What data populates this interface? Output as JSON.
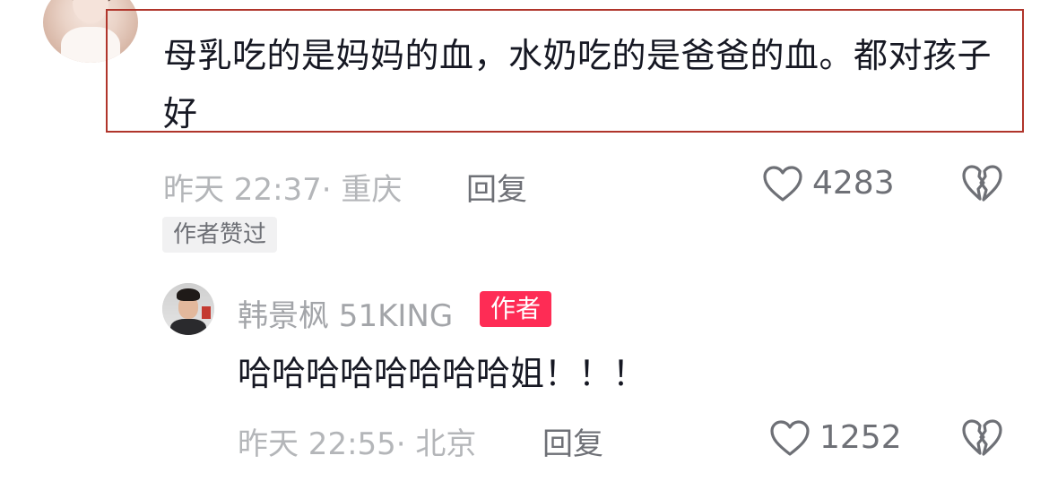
{
  "comment": {
    "text": "母乳吃的是妈妈的血，水奶吃的是爸爸的血。都对孩子好",
    "meta": "昨天 22:37· 重庆",
    "reply_label": "回复",
    "like_count": "4283",
    "badge": "作者赞过"
  },
  "reply": {
    "username": "韩景枫 51KING",
    "author_badge": "作者",
    "text": "哈哈哈哈哈哈哈哈姐！！！",
    "meta": "昨天 22:55· 北京",
    "reply_label": "回复",
    "like_count": "1252"
  },
  "colors": {
    "highlight_border": "#b0352b",
    "author_badge_bg": "#fe2c55",
    "text_primary": "#161823",
    "text_secondary": "#b4b6b9",
    "icon_gray": "#6e7076"
  },
  "icons": {
    "like": "heart-icon",
    "dislike": "broken-heart-icon"
  }
}
